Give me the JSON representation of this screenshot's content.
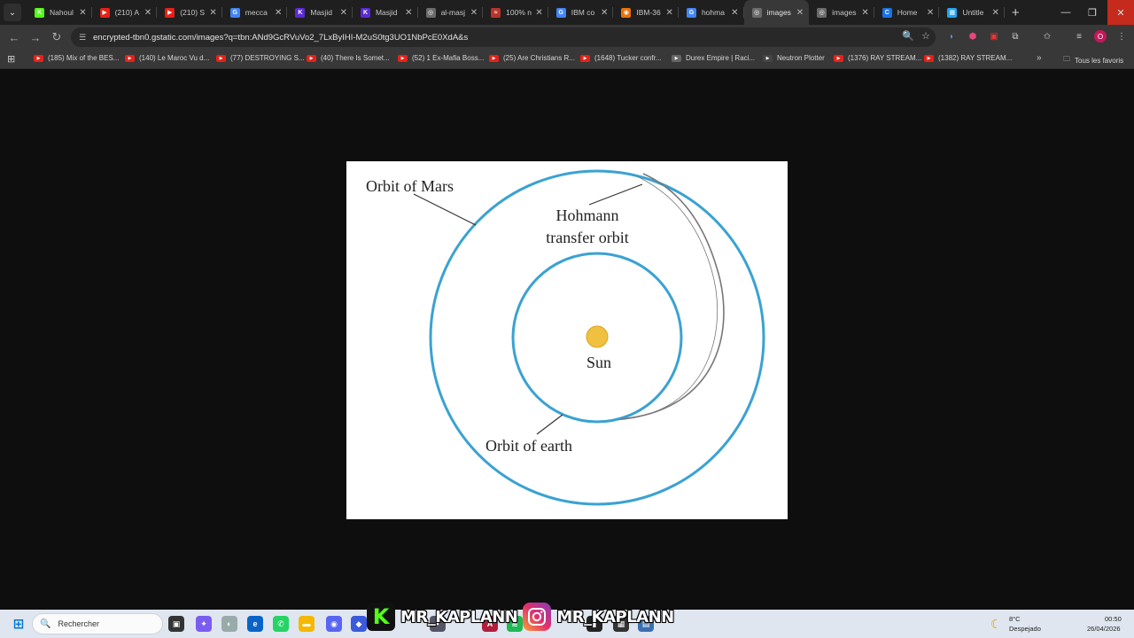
{
  "browser": {
    "tabs": [
      {
        "title": "Nahoul",
        "favicon_color": "#53fc18",
        "favicon_glyph": "K"
      },
      {
        "title": "(210) A",
        "favicon_color": "#e62117",
        "favicon_glyph": "▶"
      },
      {
        "title": "(210) S",
        "favicon_color": "#e62117",
        "favicon_glyph": "▶"
      },
      {
        "title": "mecca",
        "favicon_color": "#4285f4",
        "favicon_glyph": "G"
      },
      {
        "title": "Masjid",
        "favicon_color": "#5b2bd6",
        "favicon_glyph": "K"
      },
      {
        "title": "Masjid",
        "favicon_color": "#5b2bd6",
        "favicon_glyph": "K"
      },
      {
        "title": "al-masj",
        "favicon_color": "#6b6b6b",
        "favicon_glyph": "◎"
      },
      {
        "title": "100% n",
        "favicon_color": "#b7342a",
        "favicon_glyph": "≈"
      },
      {
        "title": "IBM co",
        "favicon_color": "#4285f4",
        "favicon_glyph": "G"
      },
      {
        "title": "IBM-36",
        "favicon_color": "#e8710a",
        "favicon_glyph": "◉"
      },
      {
        "title": "hohma",
        "favicon_color": "#4285f4",
        "favicon_glyph": "G"
      },
      {
        "title": "images",
        "favicon_color": "#6b6b6b",
        "favicon_glyph": "◎",
        "active": true
      },
      {
        "title": "images",
        "favicon_color": "#6b6b6b",
        "favicon_glyph": "◎"
      },
      {
        "title": "Home",
        "favicon_color": "#1a73e8",
        "favicon_glyph": "C"
      },
      {
        "title": "Untitle",
        "favicon_color": "#20a4f3",
        "favicon_glyph": "▦"
      }
    ],
    "new_tab_glyph": "+",
    "url": "encrypted-tbn0.gstatic.com/images?q=tbn:ANd9GcRVuVo2_7LxByIHI-M2uS0tg3UO1NbPcE0XdA&s",
    "bookmarks": [
      {
        "label": "(185) Mix of the BES..."
      },
      {
        "label": "(140) Le Maroc Vu d..."
      },
      {
        "label": "(77) DESTROYING S..."
      },
      {
        "label": "(40) There Is Somet..."
      },
      {
        "label": "(52) 1 Ex-Mafia Boss..."
      },
      {
        "label": "(25) Are Christians R..."
      },
      {
        "label": "(1648) Tucker confr..."
      },
      {
        "label": "Durex Empire | Raci..."
      },
      {
        "label": "Neutron Plotter"
      },
      {
        "label": "(1376) RAY STREAM..."
      },
      {
        "label": "(1382) RAY STREAM..."
      }
    ],
    "all_bookmarks_label": "Tous les favoris"
  },
  "diagram": {
    "orbit_mars_label": "Orbit of Mars",
    "hohmann_label_line1": "Hohmann",
    "hohmann_label_line2": "transfer orbit",
    "sun_label": "Sun",
    "orbit_earth_label": "Orbit of earth",
    "orbit_color": "#3aa2d2",
    "transfer_color": "#777777",
    "sun_color": "#f0c040"
  },
  "taskbar": {
    "search_placeholder": "Rechercher",
    "streamer_name_1": "MR_KAPLANN",
    "streamer_name_2": "MR_KAPLANN",
    "weather_temp": "8°C",
    "weather_desc": "Despejado",
    "time": "00:50",
    "date": "26/04/2026"
  }
}
